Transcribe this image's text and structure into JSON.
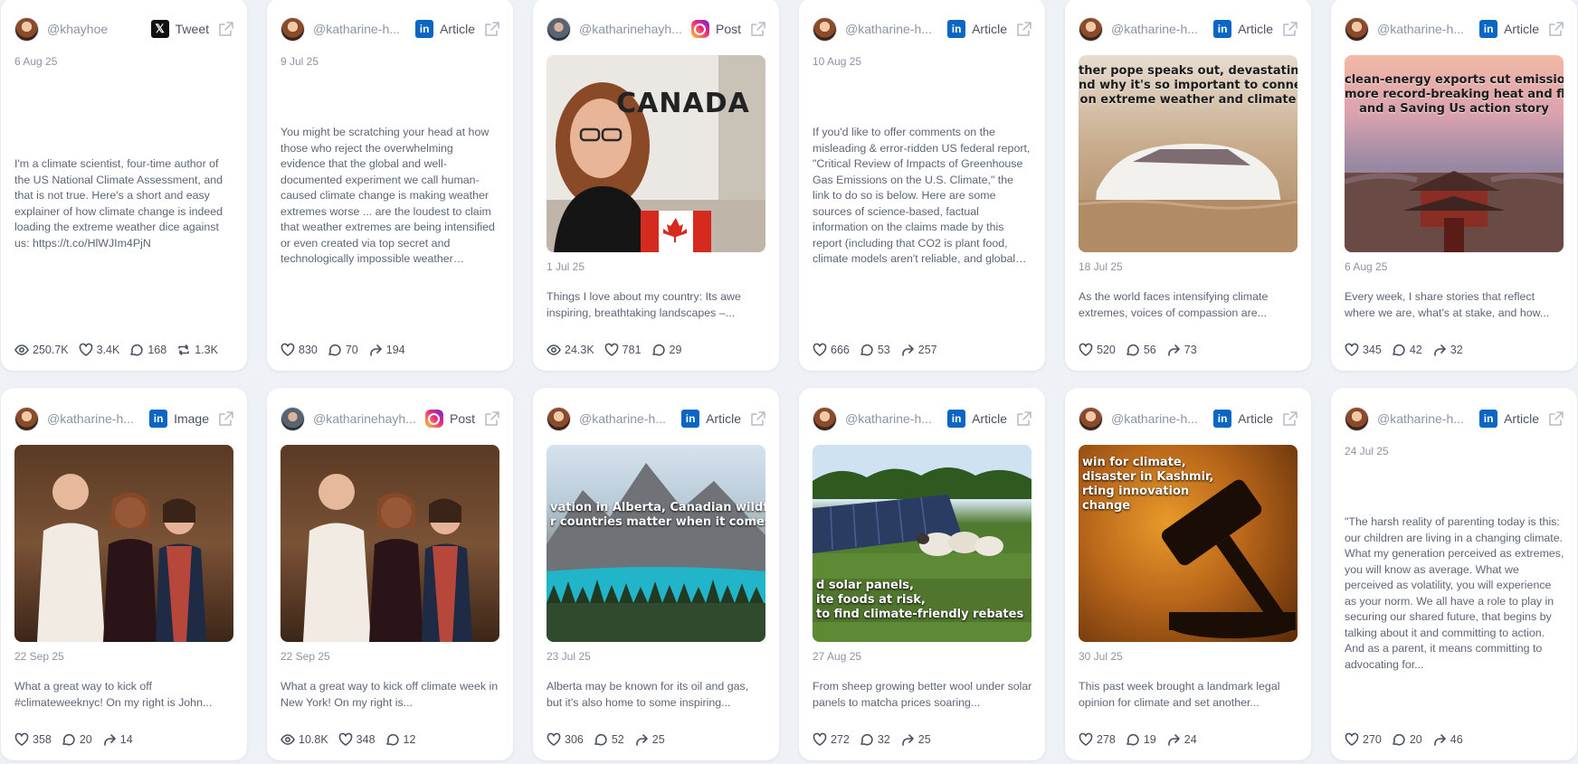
{
  "cards": [
    {
      "handle": "@khayhoe",
      "platform": "Tweet",
      "platform_icon": "x-icon",
      "date": "6 Aug 25",
      "text": "I'm a climate scientist, four-time author of the US National Climate Assessment, and that is not true. Here's a short and easy explainer of how climate change is indeed loading the extreme weather dice against us: https://t.co/HlWJIm4PjN",
      "stats": [
        {
          "icon": "eye-icon",
          "value": "250.7K"
        },
        {
          "icon": "heart-icon",
          "value": "3.4K"
        },
        {
          "icon": "comment-icon",
          "value": "168"
        },
        {
          "icon": "retweet-icon",
          "value": "1.3K"
        }
      ]
    },
    {
      "handle": "@katharine-h...",
      "platform": "Article",
      "platform_icon": "linkedin-icon",
      "date": "9 Jul 25",
      "text": "You might be scratching your head at how those who reject the overwhelming evidence that the global and well-documented experiment we call human-caused climate change is making weather extremes worse ... are the loudest to claim that weather extremes are being intensified or even created via top secret and technologically impossible weather modification...",
      "stats": [
        {
          "icon": "heart-icon",
          "value": "830"
        },
        {
          "icon": "comment-icon",
          "value": "70"
        },
        {
          "icon": "share-icon",
          "value": "194"
        }
      ]
    },
    {
      "handle": "@katharinehayh...",
      "platform": "Post",
      "platform_icon": "instagram-icon",
      "date": "1 Jul 25",
      "image_caption": "CANADA",
      "text": "Things I love about my country: Its awe inspiring, breathtaking landscapes –...",
      "stats": [
        {
          "icon": "eye-icon",
          "value": "24.3K"
        },
        {
          "icon": "heart-icon",
          "value": "781"
        },
        {
          "icon": "comment-icon",
          "value": "29"
        }
      ]
    },
    {
      "handle": "@katharine-h...",
      "platform": "Article",
      "platform_icon": "linkedin-icon",
      "date": "10 Aug 25",
      "text": "If you'd like to offer comments on the misleading & error-ridden US federal report, \"Critical Review of Impacts of Greenhouse Gas Emissions on the U.S. Climate,\" the link to do so is below. Here are some sources of science-based, factual information on the claims made by this report (including that CO2 is plant food, climate models aren't reliable, and global warming isn't affecting extreme...",
      "stats": [
        {
          "icon": "heart-icon",
          "value": "666"
        },
        {
          "icon": "comment-icon",
          "value": "53"
        },
        {
          "icon": "share-icon",
          "value": "257"
        }
      ]
    },
    {
      "handle": "@katharine-h...",
      "platform": "Article",
      "platform_icon": "linkedin-icon",
      "date": "18 Jul 25",
      "image_caption": "ther pope speaks out, devastating Texas flo\nnd why it's so important to connect the dots\non extreme weather and climate",
      "text": "As the world faces intensifying climate extremes, voices of compassion are...",
      "stats": [
        {
          "icon": "heart-icon",
          "value": "520"
        },
        {
          "icon": "comment-icon",
          "value": "56"
        },
        {
          "icon": "share-icon",
          "value": "73"
        }
      ]
    },
    {
      "handle": "@katharine-h...",
      "platform": "Article",
      "platform_icon": "linkedin-icon",
      "date": "6 Aug 25",
      "image_caption": "clean-energy exports cut emissions wor\nmore record-breaking heat and floods,\nand a Saving Us action story",
      "text": "Every week, I share stories that reflect where we are, what's at stake, and how...",
      "stats": [
        {
          "icon": "heart-icon",
          "value": "345"
        },
        {
          "icon": "comment-icon",
          "value": "42"
        },
        {
          "icon": "share-icon",
          "value": "32"
        }
      ]
    },
    {
      "handle": "@katharine-h...",
      "platform": "Image",
      "platform_icon": "linkedin-icon",
      "date": "22 Sep 25",
      "text": "What a great way to kick off #climateweeknyc! On my right is John...",
      "stats": [
        {
          "icon": "heart-icon",
          "value": "358"
        },
        {
          "icon": "comment-icon",
          "value": "20"
        },
        {
          "icon": "share-icon",
          "value": "14"
        }
      ]
    },
    {
      "handle": "@katharinehayh...",
      "platform": "Post",
      "platform_icon": "instagram-icon",
      "date": "22 Sep 25",
      "text": "What a great way to kick off climate week in New York! On my right is...",
      "stats": [
        {
          "icon": "eye-icon",
          "value": "10.8K"
        },
        {
          "icon": "heart-icon",
          "value": "348"
        },
        {
          "icon": "comment-icon",
          "value": "12"
        }
      ]
    },
    {
      "handle": "@katharine-h...",
      "platform": "Article",
      "platform_icon": "linkedin-icon",
      "date": "23 Jul 25",
      "image_caption": "vation in Alberta, Canadian wildfire season,\nr countries matter when it comes to clima",
      "text": "Alberta may be known for its oil and gas, but it's also home to some inspiring...",
      "stats": [
        {
          "icon": "heart-icon",
          "value": "306"
        },
        {
          "icon": "comment-icon",
          "value": "52"
        },
        {
          "icon": "share-icon",
          "value": "25"
        }
      ]
    },
    {
      "handle": "@katharine-h...",
      "platform": "Article",
      "platform_icon": "linkedin-icon",
      "date": "27 Aug 25",
      "image_caption": "d solar panels,\nite foods at risk,\nto find climate-friendly rebates",
      "text": "From sheep growing better wool under solar panels to matcha prices soaring...",
      "stats": [
        {
          "icon": "heart-icon",
          "value": "272"
        },
        {
          "icon": "comment-icon",
          "value": "32"
        },
        {
          "icon": "share-icon",
          "value": "25"
        }
      ]
    },
    {
      "handle": "@katharine-h...",
      "platform": "Article",
      "platform_icon": "linkedin-icon",
      "date": "30 Jul 25",
      "image_caption": "win for climate,\ndisaster in Kashmir,\nrting innovation\nchange",
      "text": "This past week brought a landmark legal opinion for climate and set another...",
      "stats": [
        {
          "icon": "heart-icon",
          "value": "278"
        },
        {
          "icon": "comment-icon",
          "value": "19"
        },
        {
          "icon": "share-icon",
          "value": "24"
        }
      ]
    },
    {
      "handle": "@katharine-h...",
      "platform": "Article",
      "platform_icon": "linkedin-icon",
      "date": "24 Jul 25",
      "text": "\"The harsh reality of parenting today is this: our children are living in a changing climate. What my generation perceived as extremes, you will know as average. What we perceived as volatility, you will experience as your norm. We all have a role to play in securing our shared future, that begins by talking about it and committing to action. And as a parent, it means committing to advocating for...",
      "stats": [
        {
          "icon": "heart-icon",
          "value": "270"
        },
        {
          "icon": "comment-icon",
          "value": "20"
        },
        {
          "icon": "share-icon",
          "value": "46"
        }
      ]
    }
  ]
}
